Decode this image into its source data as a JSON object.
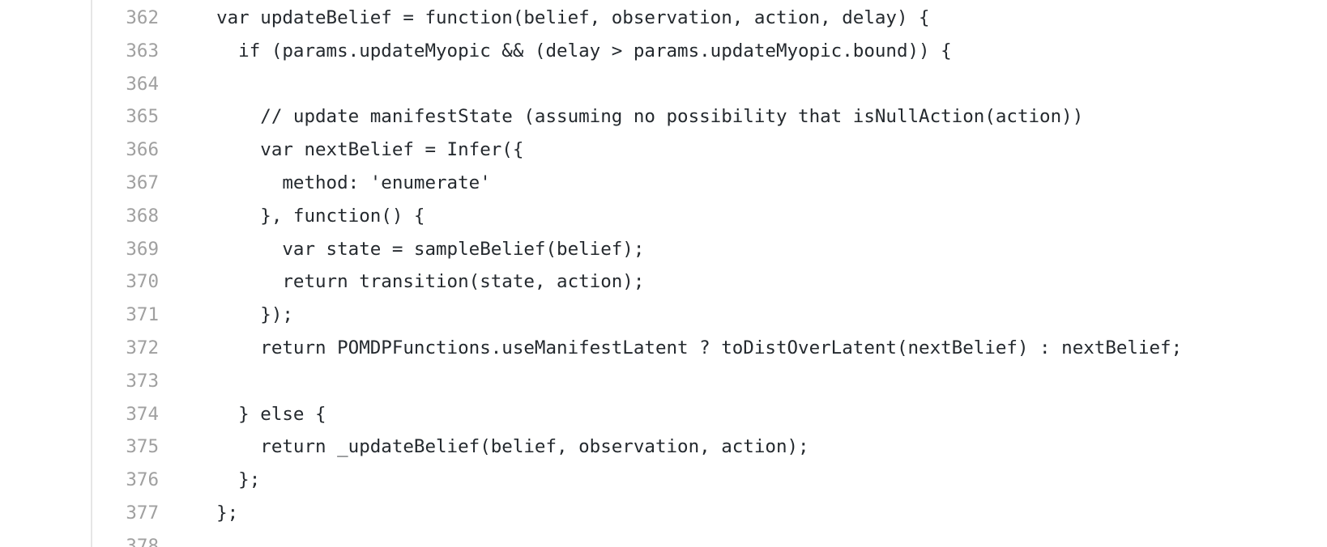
{
  "code_view": {
    "lines": [
      {
        "number": "362",
        "text": "  var updateBelief = function(belief, observation, action, delay) {"
      },
      {
        "number": "363",
        "text": "    if (params.updateMyopic && (delay > params.updateMyopic.bound)) {"
      },
      {
        "number": "364",
        "text": ""
      },
      {
        "number": "365",
        "text": "      // update manifestState (assuming no possibility that isNullAction(action))"
      },
      {
        "number": "366",
        "text": "      var nextBelief = Infer({"
      },
      {
        "number": "367",
        "text": "        method: 'enumerate'"
      },
      {
        "number": "368",
        "text": "      }, function() {"
      },
      {
        "number": "369",
        "text": "        var state = sampleBelief(belief);"
      },
      {
        "number": "370",
        "text": "        return transition(state, action);"
      },
      {
        "number": "371",
        "text": "      });"
      },
      {
        "number": "372",
        "text": "      return POMDPFunctions.useManifestLatent ? toDistOverLatent(nextBelief) : nextBelief;"
      },
      {
        "number": "373",
        "text": ""
      },
      {
        "number": "374",
        "text": "    } else {"
      },
      {
        "number": "375",
        "text": "      return _updateBelief(belief, observation, action);"
      },
      {
        "number": "376",
        "text": "    };"
      },
      {
        "number": "377",
        "text": "  };"
      },
      {
        "number": "378",
        "text": ""
      }
    ]
  }
}
